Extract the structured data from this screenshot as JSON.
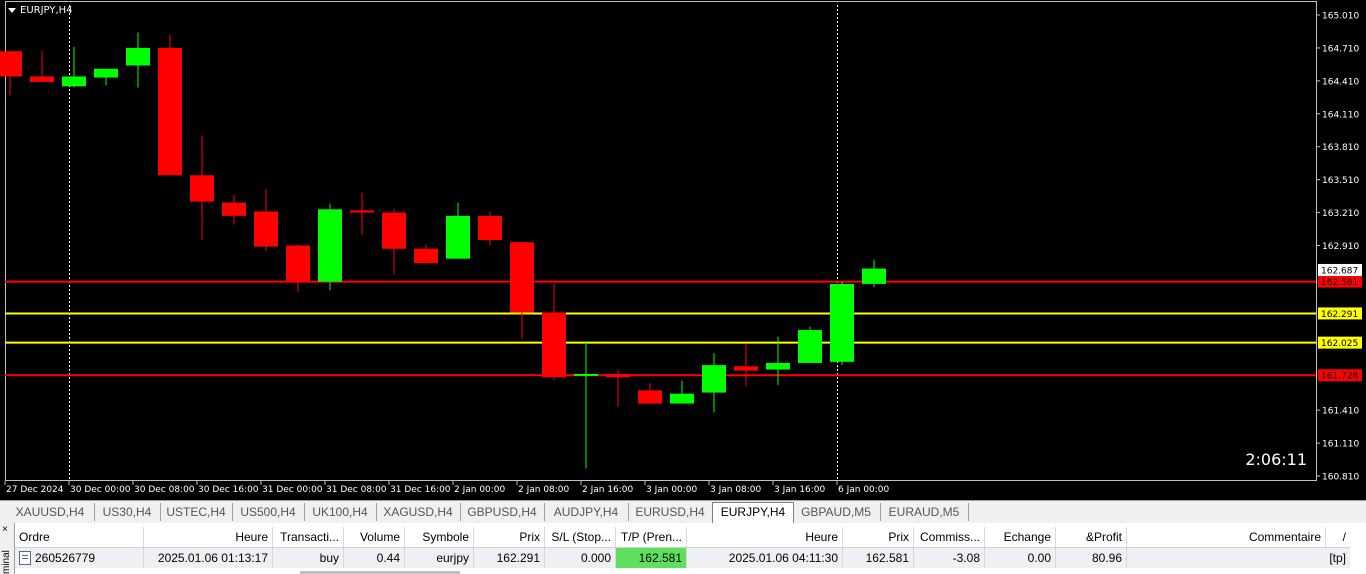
{
  "chart": {
    "title": "EURJPY,H4",
    "countdown": "2:06:11",
    "colors": {
      "background": "#000000",
      "bull": "#00ff00",
      "bear": "#ff0000",
      "grid_text": "#ffffff",
      "red_line": "#ff0000",
      "yellow_line": "#ffff00"
    },
    "price_axis_ticks": [
      "165.010",
      "164.710",
      "164.410",
      "164.110",
      "163.810",
      "163.510",
      "163.210",
      "162.910",
      "161.410",
      "161.110",
      "160.810"
    ],
    "time_axis_labels": [
      "27 Dec 2024",
      "30 Dec 00:00",
      "30 Dec 08:00",
      "30 Dec 16:00",
      "31 Dec 00:00",
      "31 Dec 08:00",
      "31 Dec 16:00",
      "2 Jan 00:00",
      "2 Jan 08:00",
      "2 Jan 16:00",
      "3 Jan 00:00",
      "3 Jan 08:00",
      "3 Jan 16:00",
      "6 Jan 00:00"
    ],
    "candles": [
      {
        "o": 164.68,
        "h": 164.68,
        "l": 164.28,
        "c": 164.45
      },
      {
        "o": 164.45,
        "h": 164.68,
        "l": 164.4,
        "c": 164.4
      },
      {
        "o": 164.36,
        "h": 164.72,
        "l": 164.35,
        "c": 164.45
      },
      {
        "o": 164.44,
        "h": 164.52,
        "l": 164.37,
        "c": 164.52
      },
      {
        "o": 164.55,
        "h": 164.85,
        "l": 164.35,
        "c": 164.71
      },
      {
        "o": 164.71,
        "h": 164.83,
        "l": 163.57,
        "c": 163.55
      },
      {
        "o": 163.55,
        "h": 163.91,
        "l": 162.96,
        "c": 163.31
      },
      {
        "o": 163.3,
        "h": 163.37,
        "l": 163.1,
        "c": 163.18
      },
      {
        "o": 163.22,
        "h": 163.42,
        "l": 162.86,
        "c": 162.9
      },
      {
        "o": 162.91,
        "h": 162.92,
        "l": 162.49,
        "c": 162.58
      },
      {
        "o": 162.58,
        "h": 163.29,
        "l": 162.5,
        "c": 163.24
      },
      {
        "o": 163.23,
        "h": 163.39,
        "l": 163.01,
        "c": 163.21
      },
      {
        "o": 163.21,
        "h": 163.24,
        "l": 162.65,
        "c": 162.88
      },
      {
        "o": 162.88,
        "h": 162.92,
        "l": 162.73,
        "c": 162.75
      },
      {
        "o": 162.79,
        "h": 163.3,
        "l": 162.79,
        "c": 163.18
      },
      {
        "o": 163.18,
        "h": 163.22,
        "l": 162.91,
        "c": 162.96
      },
      {
        "o": 162.94,
        "h": 162.94,
        "l": 162.06,
        "c": 162.3
      },
      {
        "o": 162.3,
        "h": 162.57,
        "l": 161.68,
        "c": 161.71
      },
      {
        "o": 161.73,
        "h": 162.04,
        "l": 160.88,
        "c": 161.74
      },
      {
        "o": 161.74,
        "h": 161.78,
        "l": 161.44,
        "c": 161.71
      },
      {
        "o": 161.59,
        "h": 161.66,
        "l": 161.47,
        "c": 161.47
      },
      {
        "o": 161.47,
        "h": 161.68,
        "l": 161.47,
        "c": 161.56
      },
      {
        "o": 161.57,
        "h": 161.93,
        "l": 161.39,
        "c": 161.82
      },
      {
        "o": 161.81,
        "h": 162.01,
        "l": 161.63,
        "c": 161.77
      },
      {
        "o": 161.78,
        "h": 162.08,
        "l": 161.64,
        "c": 161.84
      },
      {
        "o": 161.84,
        "h": 162.17,
        "l": 161.84,
        "c": 162.14
      },
      {
        "o": 161.85,
        "h": 162.58,
        "l": 161.82,
        "c": 162.56
      },
      {
        "o": 162.56,
        "h": 162.78,
        "l": 162.53,
        "c": 162.7
      }
    ],
    "levels": [
      {
        "price": 162.581,
        "label": "162.581",
        "kind": "red"
      },
      {
        "price": 162.291,
        "label": "162.291",
        "kind": "yellow"
      },
      {
        "price": 162.025,
        "label": "162.025",
        "kind": "yellow"
      },
      {
        "price": 161.728,
        "label": "161.728",
        "kind": "red"
      }
    ],
    "current_price_label": "162.687",
    "current_price": 162.687
  },
  "tabs": [
    {
      "label": "XAUUSD,H4",
      "active": false
    },
    {
      "label": "US30,H4",
      "active": false
    },
    {
      "label": "USTEC,H4",
      "active": false
    },
    {
      "label": "US500,H4",
      "active": false
    },
    {
      "label": "UK100,H4",
      "active": false
    },
    {
      "label": "XAGUSD,H4",
      "active": false
    },
    {
      "label": "GBPUSD,H4",
      "active": false
    },
    {
      "label": "AUDJPY,H4",
      "active": false
    },
    {
      "label": "EURUSD,H4",
      "active": false
    },
    {
      "label": "EURJPY,H4",
      "active": true
    },
    {
      "label": "GBPAUD,M5",
      "active": false
    },
    {
      "label": "EURAUD,M5",
      "active": false
    }
  ],
  "terminal": {
    "side_label": "minal",
    "close_glyph": "×",
    "columns": [
      "Ordre",
      "Heure",
      "Transacti...",
      "Volume",
      "Symbole",
      "Prix",
      "S/L (Stop...",
      "T/P (Pren...",
      "Heure",
      "Prix",
      "Commiss...",
      "Echange",
      "&Profit",
      "Commentaire",
      "/"
    ],
    "rows": [
      {
        "ordre": "260526779",
        "heure_open": "2025.01.06 01:13:17",
        "type": "buy",
        "volume": "0.44",
        "symbole": "eurjpy",
        "prix_open": "162.291",
        "sl": "0.000",
        "tp": "162.581",
        "heure_close": "2025.01.06 04:11:30",
        "prix_current": "162.581",
        "commission": "-3.08",
        "echange": "0.00",
        "profit": "80.96",
        "commentaire": "[tp]"
      }
    ]
  }
}
